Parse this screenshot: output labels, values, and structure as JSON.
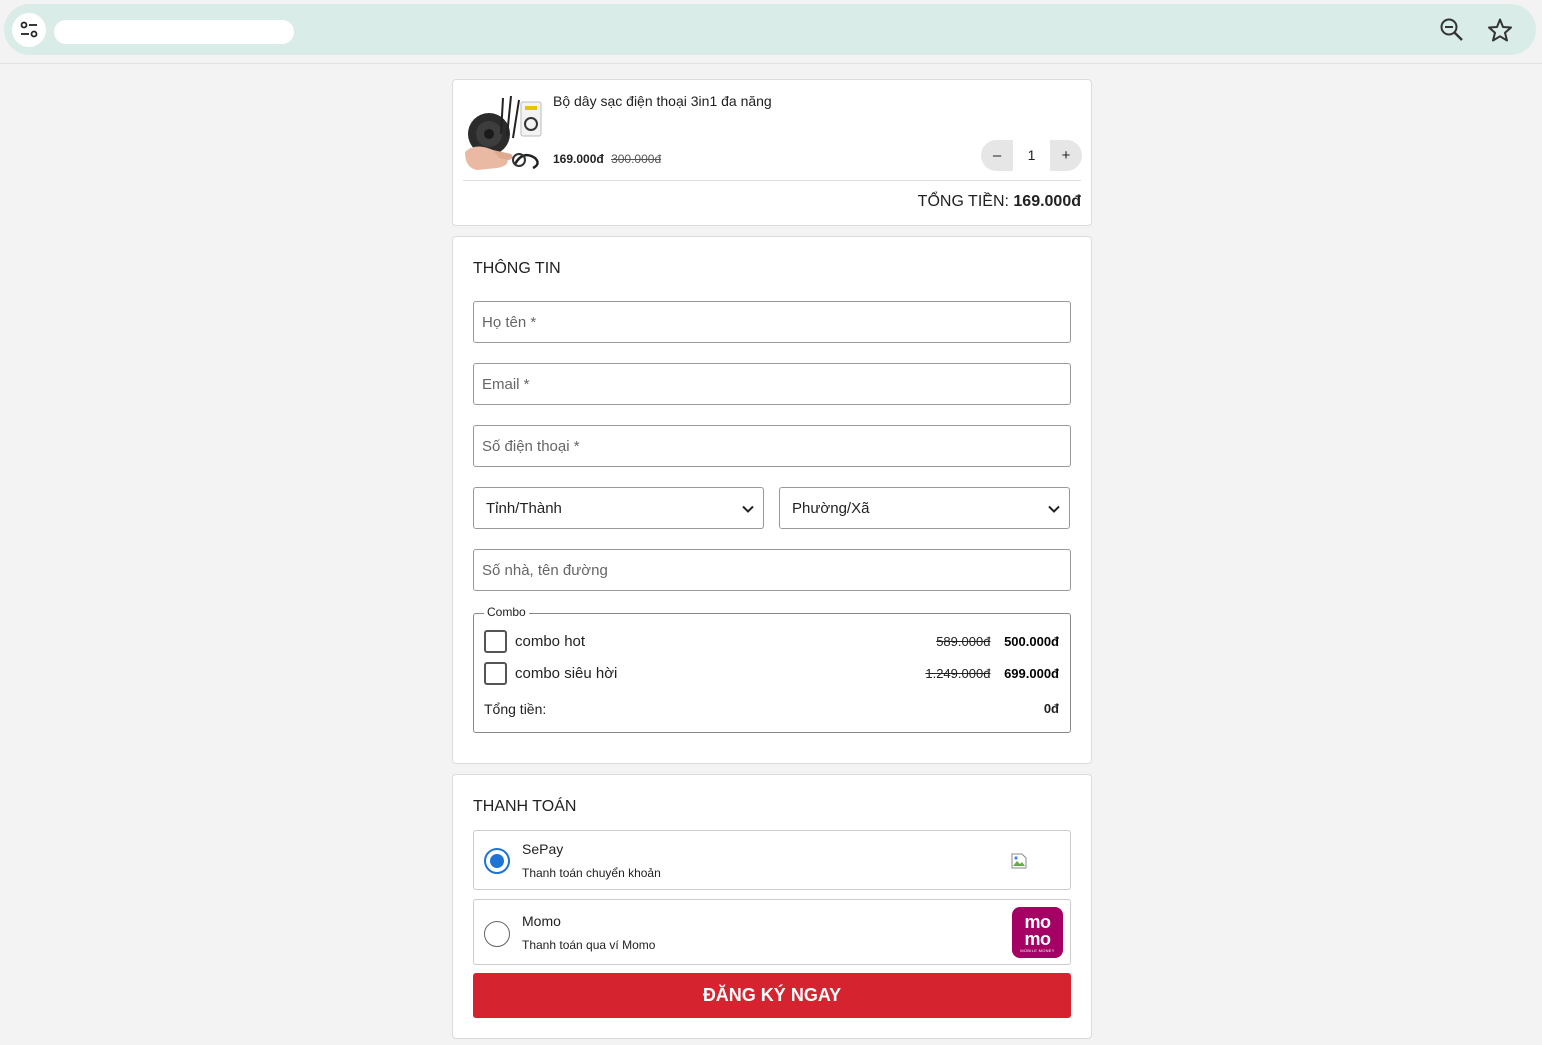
{
  "browser": {
    "site_icon": "tune-icon",
    "actions": [
      "zoom-out-icon",
      "star-icon"
    ]
  },
  "product": {
    "name": "Bộ dây sạc điện thoại 3in1 đa năng",
    "price": "169.000đ",
    "old_price": "300.000đ",
    "quantity": "1",
    "minus_label": "–",
    "plus_label": "+",
    "total_label": "TỔNG TIỀN:",
    "total_value": "169.000đ"
  },
  "info": {
    "title": "THÔNG TIN",
    "name_placeholder": "Họ tên *",
    "email_placeholder": "Email *",
    "phone_placeholder": "Số điện thoại *",
    "province_select": "Tỉnh/Thành",
    "ward_select": "Phường/Xã",
    "address_placeholder": "Số nhà, tên đường",
    "combo": {
      "legend": "Combo",
      "items": [
        {
          "label": "combo hot",
          "old_price": "589.000đ",
          "price": "500.000đ",
          "checked": false
        },
        {
          "label": "combo siêu hời",
          "old_price": "1.249.000đ",
          "price": "699.000đ",
          "checked": false
        }
      ],
      "total_label": "Tổng tiền:",
      "total_value": "0đ"
    }
  },
  "payment": {
    "title": "THANH TOÁN",
    "methods": [
      {
        "name": "SePay",
        "desc": "Thanh toán chuyển khoản",
        "selected": true
      },
      {
        "name": "Momo",
        "desc": "Thanh toán qua ví Momo",
        "selected": false,
        "logo_top": "mo",
        "logo_bottom": "mo",
        "logo_tagline": "MOBILE MONEY"
      }
    ],
    "submit_label": "ĐĂNG KÝ NGAY"
  },
  "colors": {
    "accent": "#d5232f",
    "radio": "#1e74d4",
    "momo": "#a50064",
    "omnibox": "#d9ece7"
  }
}
